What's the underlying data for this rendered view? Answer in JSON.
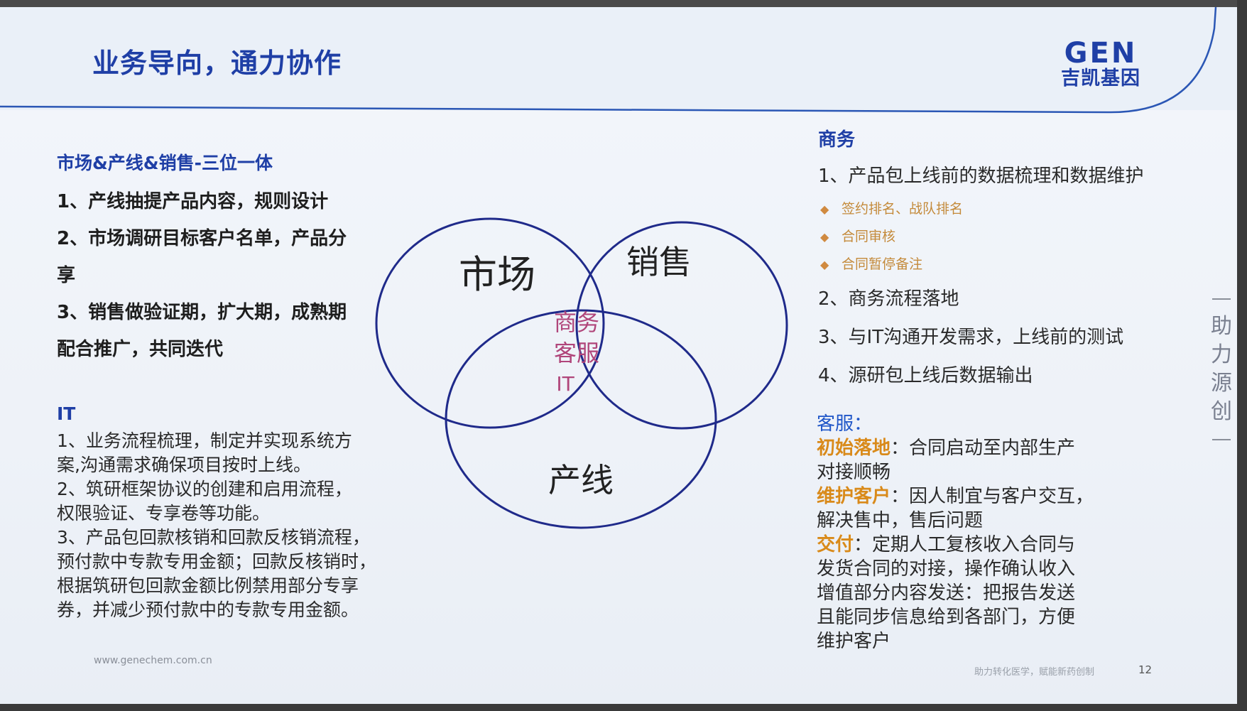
{
  "slide": {
    "title": "业务导向，通力协作",
    "logo": {
      "top": "GEN",
      "bottom": "吉凯基因"
    },
    "left": {
      "section1_head": "市场&产线&销售-三位一体",
      "section1_lines": [
        "1、产线抽提产品内容，规则设计",
        "2、市场调研目标客户名单，产品分",
        "享",
        "3、销售做验证期，扩大期，成熟期",
        "配合推广，共同迭代"
      ],
      "it_head": "IT",
      "it_lines": [
        "1、业务流程梳理，制定并实现系统方",
        "案,沟通需求确保项目按时上线。",
        "2、筑研框架协议的创建和启用流程，",
        "权限验证、专享卷等功能。",
        "3、产品包回款核销和回款反核销流程，",
        "预付款中专款专用金额；回款反核销时，",
        "根据筑研包回款金额比例禁用部分专享",
        "券，并减少预付款中的专款专用金额。"
      ]
    },
    "venn": {
      "market": "市场",
      "sales": "销售",
      "production": "产线",
      "center_lines": [
        "商务",
        "客服",
        "IT"
      ]
    },
    "right": {
      "business_head": "商务",
      "business_item1": "1、产品包上线前的数据梳理和数据维护",
      "bullets": [
        "签约排名、战队排名",
        "合同审核",
        "合同暂停备注"
      ],
      "business_items": [
        "2、商务流程落地",
        "3、与IT沟通开发需求，上线前的测试",
        "4、源研包上线后数据输出"
      ],
      "cs_head": "客服：",
      "cs_items": [
        {
          "label": "初始落地",
          "text_lines": [
            "：合同启动至内部生产",
            "对接顺畅"
          ]
        },
        {
          "label": "维护客户",
          "text_lines": [
            "：因人制宜与客户交互，",
            "解决售中，售后问题"
          ]
        },
        {
          "label": "交付",
          "text_lines": [
            "：定期人工复核收入合同与",
            "发货合同的对接，操作确认收入"
          ]
        }
      ],
      "cs_tail": [
        "增值部分内容发送：把报告发送",
        "且能同步信息给到各部门，方便",
        "维护客户"
      ]
    },
    "footer": {
      "url": "www.genechem.com.cn",
      "right_text": "助力转化医学，赋能新药创制",
      "page": "12"
    },
    "vertical_tagline": "助力源创",
    "colors": {
      "title_blue": "#1f3fa6",
      "circle": "#1f2a8a",
      "center_text": "#b0457a",
      "orange": "#d98a1a"
    }
  }
}
